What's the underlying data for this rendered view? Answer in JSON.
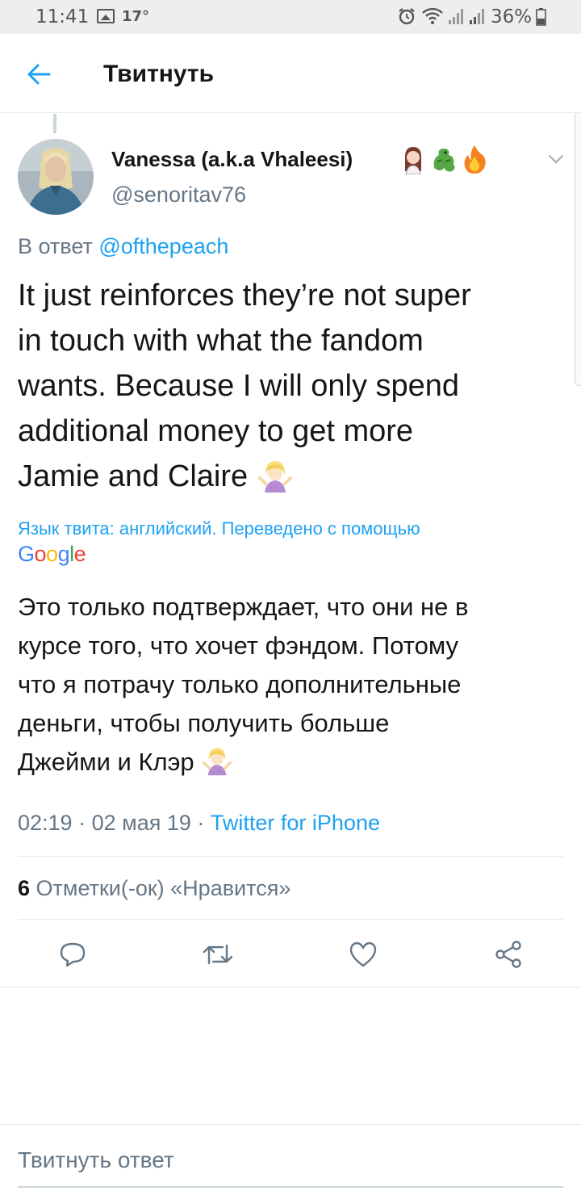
{
  "status_bar": {
    "time": "11:41",
    "temperature": "17°",
    "battery": "36%",
    "icons": [
      "gallery-icon",
      "alarm-icon",
      "wifi-icon",
      "signal-icon",
      "signal-icon",
      "battery-icon"
    ]
  },
  "header": {
    "title": "Твитнуть",
    "back_icon": "arrow-left-icon"
  },
  "tweet": {
    "author": {
      "display_name": "Vanessa (a.k.a Vhaleesi)",
      "name_emojis": [
        "woman-icon",
        "dragon-icon",
        "fire-icon"
      ],
      "handle": "@senoritav76"
    },
    "reply_prefix": "В ответ",
    "reply_to": "@ofthepeach",
    "text_lines": [
      "It just reinforces they’re not super",
      "in touch with what the fandom",
      "wants. Because I will only spend",
      "additional money to get more",
      "Jamie and Claire"
    ],
    "text_emoji": "shrug-emoji",
    "translation_label": "Язык твита: английский. Переведено с помощью",
    "translation_provider": "Google",
    "translation_lines": [
      "Это только подтверждает, что они не в",
      "курсе того, что хочет фэндом. Потому",
      "что я потрачу только дополнительные",
      "деньги, чтобы получить больше",
      "Джейми и Клэр"
    ],
    "time": "02:19",
    "date": "02 мая 19",
    "source": "Twitter for iPhone",
    "likes_count": "6",
    "likes_label": "Отметки(-ок) «Нравится»"
  },
  "actions": [
    "reply-icon",
    "retweet-icon",
    "like-icon",
    "share-icon"
  ],
  "compose": {
    "placeholder": "Твитнуть ответ"
  },
  "colors": {
    "accent": "#1da1f2",
    "secondary_text": "#657786",
    "primary_text": "#14171a",
    "divider": "#e1e8ed"
  }
}
